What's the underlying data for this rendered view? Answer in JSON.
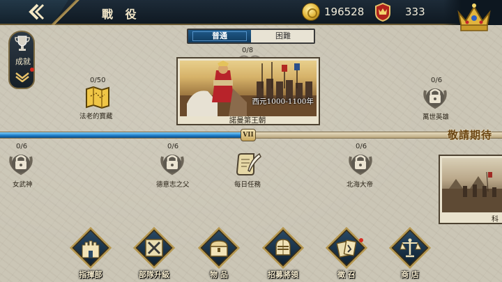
{
  "header": {
    "title": "戰 役",
    "gold": "196528",
    "rank_points": "333"
  },
  "sidebar": {
    "achievements_label": "成就"
  },
  "difficulty": {
    "normal": "普通",
    "hard": "困難",
    "selected": "普通"
  },
  "campaign": {
    "count": "0/8",
    "name": "諾曼第王朝",
    "period": "西元1000-1100年"
  },
  "nodes": [
    {
      "count": "0/50",
      "label": "法老的寶藏",
      "icon": "treasure-map-icon"
    },
    {
      "count": "0/6",
      "label": "萬世英雄",
      "icon": "lock-laurel-icon"
    },
    {
      "count": "0/6",
      "label": "女武神",
      "icon": "lock-laurel-icon"
    },
    {
      "count": "0/6",
      "label": "德意志之父",
      "icon": "lock-laurel-icon"
    },
    {
      "label": "每日任務",
      "icon": "scroll-quill-icon"
    },
    {
      "count": "0/6",
      "label": "北海大帝",
      "icon": "lock-laurel-icon"
    }
  ],
  "timeline": {
    "era": "VII",
    "coming_soon": "敬請期待",
    "progress": 0.49
  },
  "preview": {
    "label": "科"
  },
  "menu": [
    {
      "label": "指揮部",
      "icon": "castle-icon"
    },
    {
      "label": "部隊升級",
      "icon": "crossed-swords-icon"
    },
    {
      "label": "物 品",
      "icon": "treasure-chest-icon"
    },
    {
      "label": "招募將領",
      "icon": "knight-helmet-icon"
    },
    {
      "label": "徵 召",
      "icon": "cards-icon"
    },
    {
      "label": "商 店",
      "icon": "balance-scale-icon"
    }
  ],
  "colors": {
    "accent_blue": "#1a79c4",
    "gold_trim": "#b6974e",
    "topbar": "#0f1922"
  }
}
